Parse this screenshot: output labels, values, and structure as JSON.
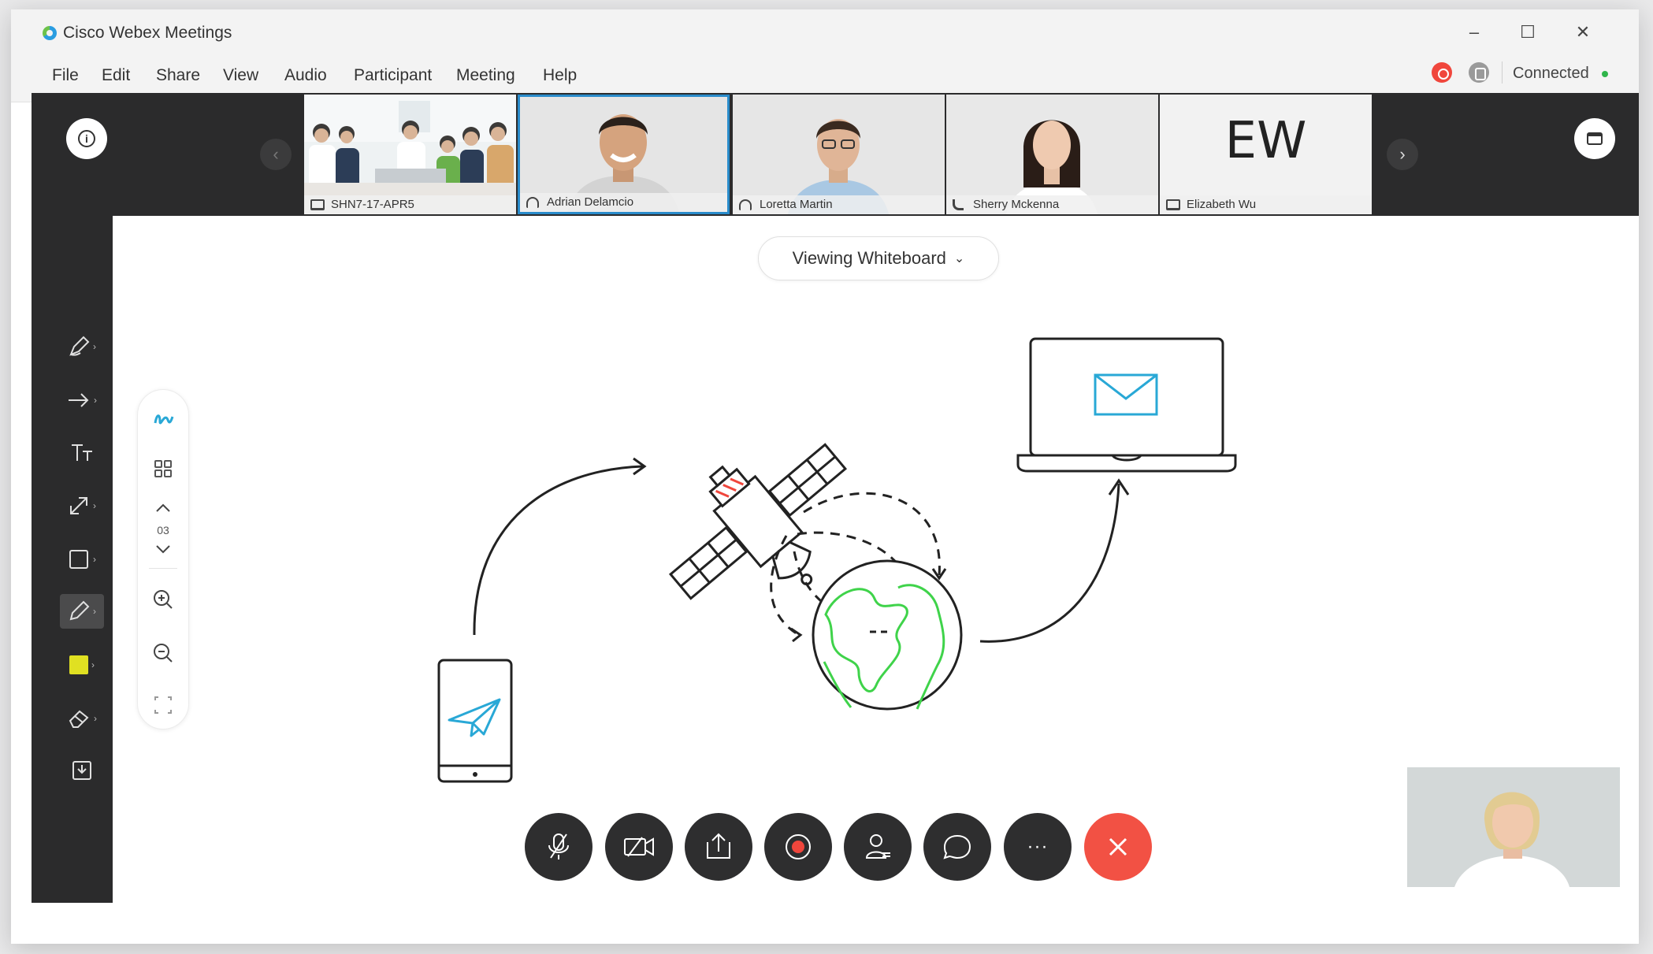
{
  "window": {
    "title": "Cisco Webex Meetings",
    "controls": {
      "minimize": "–",
      "maximize": "☐",
      "close": "✕"
    }
  },
  "menu": {
    "items": [
      "File",
      "Edit",
      "Share",
      "View",
      "Audio",
      "Participant",
      "Meeting",
      "Help"
    ],
    "status_text": "Connected",
    "colors": {
      "record": "#f0463c",
      "lock": "#9a9a9a",
      "connected_dot": "#2fb54a"
    }
  },
  "participants": [
    {
      "name": "SHN7-17-APR5",
      "type": "room-system",
      "icon": "room-device-icon"
    },
    {
      "name": "Adrian Delamcio",
      "type": "video",
      "icon": "headset-icon",
      "active_speaker": true
    },
    {
      "name": "Loretta Martin",
      "type": "video",
      "icon": "headset-icon"
    },
    {
      "name": "Sherry Mckenna",
      "type": "video",
      "icon": "phone-icon"
    },
    {
      "name": "Elizabeth Wu",
      "type": "initials",
      "initials": "EW",
      "icon": "room-device-icon"
    }
  ],
  "whiteboard": {
    "viewing_label": "Viewing Whiteboard",
    "page_number": "03",
    "colors": {
      "accent": "#29a8d6",
      "globe": "#3fd34a",
      "satellite_red": "#f0463c",
      "stroke": "#222222"
    }
  },
  "toolbar": {
    "tools": [
      "pen-tool-icon",
      "arrow-tool-icon",
      "text-tool-icon",
      "line-tool-icon",
      "shape-tool-icon",
      "pencil-tool-icon",
      "color-swatch",
      "eraser-tool-icon",
      "save-tool-icon"
    ],
    "active_tool": "pencil-tool-icon",
    "swatch_color": "#e0e022"
  },
  "controls": {
    "buttons": [
      "mute-icon",
      "video-off-icon",
      "share-icon",
      "record-icon",
      "participants-icon",
      "chat-icon",
      "more-icon",
      "end-call-icon"
    ],
    "more_label": "···",
    "end_color": "#f25144"
  }
}
